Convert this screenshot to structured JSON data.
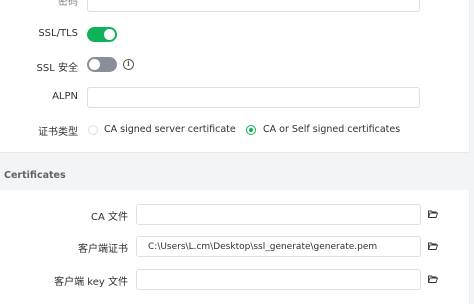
{
  "fields": {
    "password_label": "密码",
    "ssl_tls_label": "SSL/TLS",
    "ssl_tls_enabled": true,
    "ssl_secure_label": "SSL 安全",
    "ssl_secure_enabled": false,
    "alpn_label": "ALPN",
    "alpn_value": "",
    "cert_type_label": "证书类型",
    "cert_type_options": [
      {
        "label": "CA signed server certificate",
        "selected": false
      },
      {
        "label": "CA or Self signed certificates",
        "selected": true
      }
    ]
  },
  "certificates": {
    "section_title": "Certificates",
    "ca_file_label": "CA 文件",
    "ca_file_value": "",
    "client_cert_label": "客户端证书",
    "client_cert_value": "C:\\Users\\L.cm\\Desktop\\ssl_generate\\generate.pem",
    "client_key_label": "客户端 key 文件",
    "client_key_value": ""
  },
  "icons": {
    "info": "info-icon",
    "folder": "folder-open-icon"
  },
  "colors": {
    "accent": "#10b259",
    "switch_off": "#8a8e99"
  }
}
